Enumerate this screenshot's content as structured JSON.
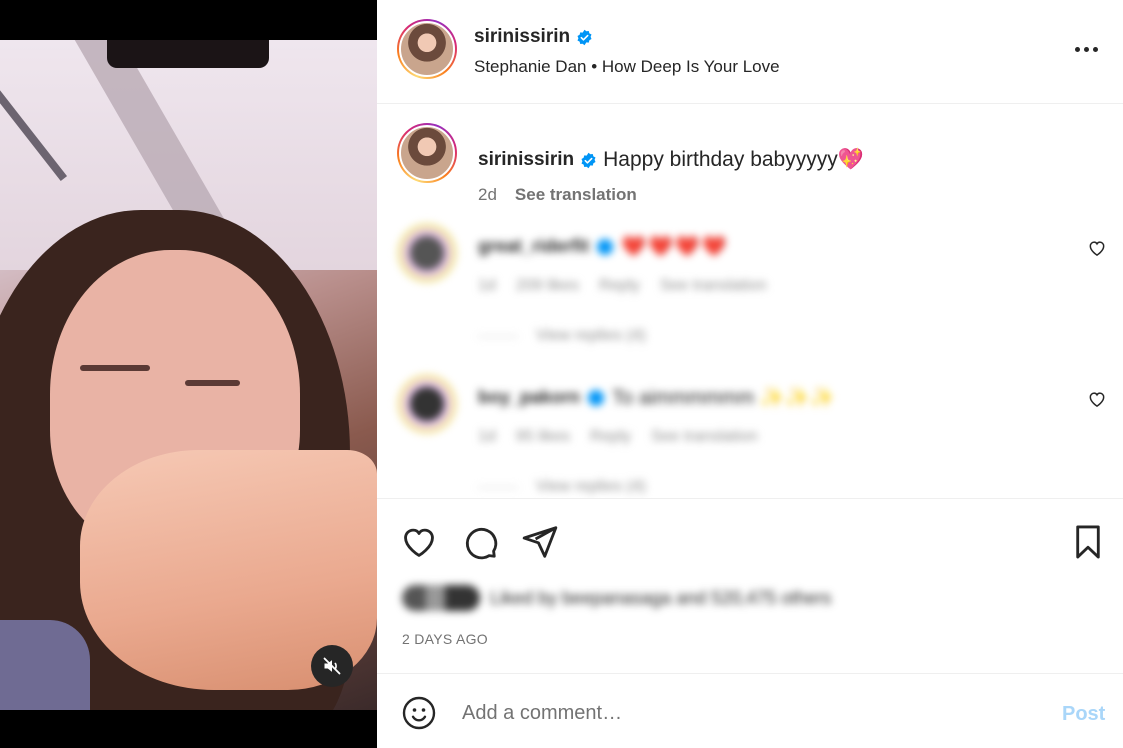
{
  "post": {
    "username": "sirinissirin",
    "audio_artist": "Stephanie Dan",
    "audio_separator": "•",
    "audio_track": "How Deep Is Your Love"
  },
  "caption": {
    "username": "sirinissirin",
    "text": "Happy birthday babyyyyy💖",
    "age": "2d",
    "see_translation": "See translation"
  },
  "comments": [
    {
      "username": "great_riderfit",
      "text": "❤️❤️❤️❤️",
      "age": "1d",
      "likes": "209 likes",
      "reply": "Reply",
      "see_translation": "See translation",
      "view_replies": "View replies (4)"
    },
    {
      "username": "boy_pakorn",
      "text": "To aimmmmmm ✨✨✨",
      "age": "1d",
      "likes": "95 likes",
      "reply": "Reply",
      "see_translation": "See translation",
      "view_replies": "View replies (4)"
    }
  ],
  "likes_text": "Liked by beepanasaga and 520,475 others",
  "timestamp": "2 DAYS AGO",
  "comment_input": {
    "placeholder": "Add a comment…",
    "post_label": "Post"
  },
  "colors": {
    "verified": "#0095f6",
    "post_disabled": "#a9d6f9",
    "text": "#262626",
    "muted": "#737373"
  },
  "icons": {
    "mute": "speaker-muted-icon",
    "more": "more-options-icon",
    "like": "heart-icon",
    "comment": "comment-bubble-icon",
    "share": "paper-plane-icon",
    "save": "bookmark-icon",
    "emoji": "smiley-icon"
  }
}
